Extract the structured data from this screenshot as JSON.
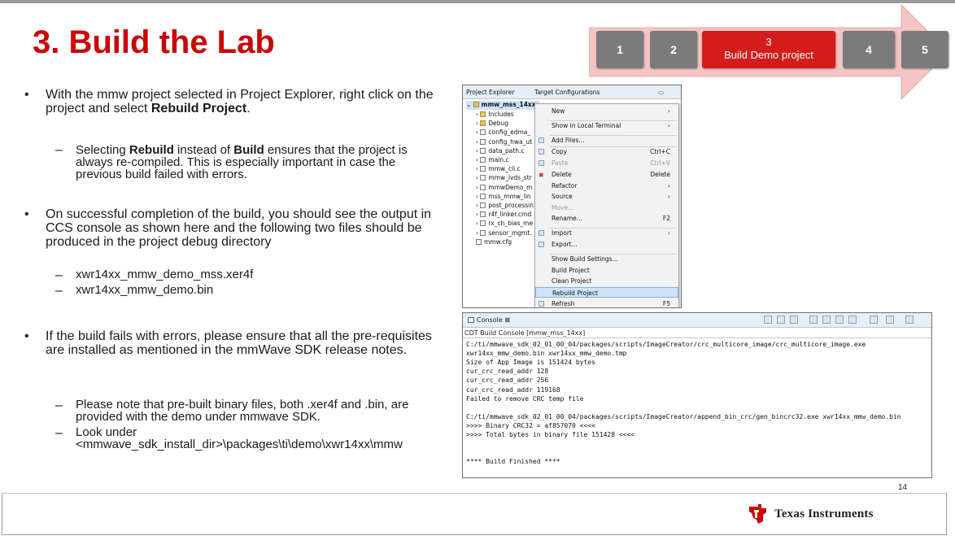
{
  "slide": {
    "title": "3. Build the Lab",
    "page_number": "14",
    "brand": "Texas Instruments"
  },
  "steps": {
    "items": [
      "1",
      "2",
      "3",
      "4",
      "5"
    ],
    "active_label": "Build Demo project",
    "active_index": 3,
    "colors": {
      "inactive": "#7b7b7b",
      "active": "#d41c1c",
      "arrow": "#f1c0c0"
    }
  },
  "bullets": {
    "b1": "With the mmw project selected in Project Explorer, right click on the project and select ",
    "b1_bold": "Rebuild Project",
    "b1_end": ".",
    "b1_sub_pre": "Selecting ",
    "b1_sub_bold1": "Rebuild",
    "b1_sub_mid": " instead of ",
    "b1_sub_bold2": "Build",
    "b1_sub_post": " ensures that the project is always re-compiled. This is especially important in case the previous build failed with errors.",
    "b2": "On successful completion of the build, you should see the output in CCS console as shown here and the following two files should be produced in the project debug directory",
    "b2_sub1": "xwr14xx_mmw_demo_mss.xer4f",
    "b2_sub2": "xwr14xx_mmw_demo.bin",
    "b3": "If the build fails with errors, please ensure that all the pre-requisites are installed as mentioned in the mmWave SDK release notes.",
    "b3_sub1": "Please note that pre-built binary files, both .xer4f and .bin, are provided with the demo under mmwave SDK.",
    "b3_sub2": "Look under <mmwave_sdk_install_dir>\\packages\\ti\\demo\\xwr14xx\\mmw"
  },
  "project_explorer": {
    "tab1": "Project Explorer",
    "tab2": "Target Configurations",
    "project": "mmw_mss_14xx",
    "tree": [
      "Includes",
      "Debug",
      "config_edma_",
      "config_hwa_ut",
      "data_path.c",
      "main.c",
      "mmw_cli.c",
      "mmw_lvds_str",
      "mmwDemo_m",
      "mss_mmw_lin",
      "post_processin",
      "r4f_linker.cmd",
      "rx_ch_bias_me",
      "sensor_mgmt.",
      "mmw.cfg"
    ],
    "menu": [
      {
        "label": "New",
        "shortcut": "›"
      },
      {
        "label": "Show in Local Terminal",
        "shortcut": "›"
      },
      {
        "label": "Add Files...",
        "shortcut": ""
      },
      {
        "label": "Copy",
        "shortcut": "Ctrl+C"
      },
      {
        "label": "Paste",
        "shortcut": "Ctrl+V"
      },
      {
        "label": "Delete",
        "shortcut": "Delete"
      },
      {
        "label": "Refactor",
        "shortcut": "›"
      },
      {
        "label": "Source",
        "shortcut": "›"
      },
      {
        "label": "Move...",
        "shortcut": ""
      },
      {
        "label": "Rename...",
        "shortcut": "F2"
      },
      {
        "label": "Import",
        "shortcut": "›"
      },
      {
        "label": "Export...",
        "shortcut": ""
      },
      {
        "label": "Show Build Settings...",
        "shortcut": ""
      },
      {
        "label": "Build Project",
        "shortcut": ""
      },
      {
        "label": "Clean Project",
        "shortcut": ""
      },
      {
        "label": "Rebuild Project",
        "shortcut": ""
      },
      {
        "label": "Refresh",
        "shortcut": "F5"
      }
    ]
  },
  "console": {
    "tab": "Console",
    "subtitle": "CDT Build Console [mmw_mss_14xx]",
    "lines": [
      "C:/ti/mmwave_sdk_02_01_00_04/packages/scripts/ImageCreator/crc_multicore_image/crc_multicore_image.exe",
      "xwr14xx_mmw_demo.bin xwr14xx_mmw_demo.tmp",
      "Size of App Image is 151424 bytes",
      "cur_crc_read_addr 128",
      "cur_crc_read_addr 256",
      "cur_crc_read_addr 119168",
      "Failed to remove CRC temp file",
      "",
      "C:/ti/mmwave_sdk_02_01_00_04/packages/scripts/ImageCreator/append_bin_crc/gen_bincrc32.exe xwr14xx_mmw_demo.bin",
      ">>>> Binary CRC32 = af857070 <<<<",
      ">>>> Total bytes in binary file 151428 <<<<",
      "",
      "",
      "**** Build Finished ****"
    ]
  }
}
